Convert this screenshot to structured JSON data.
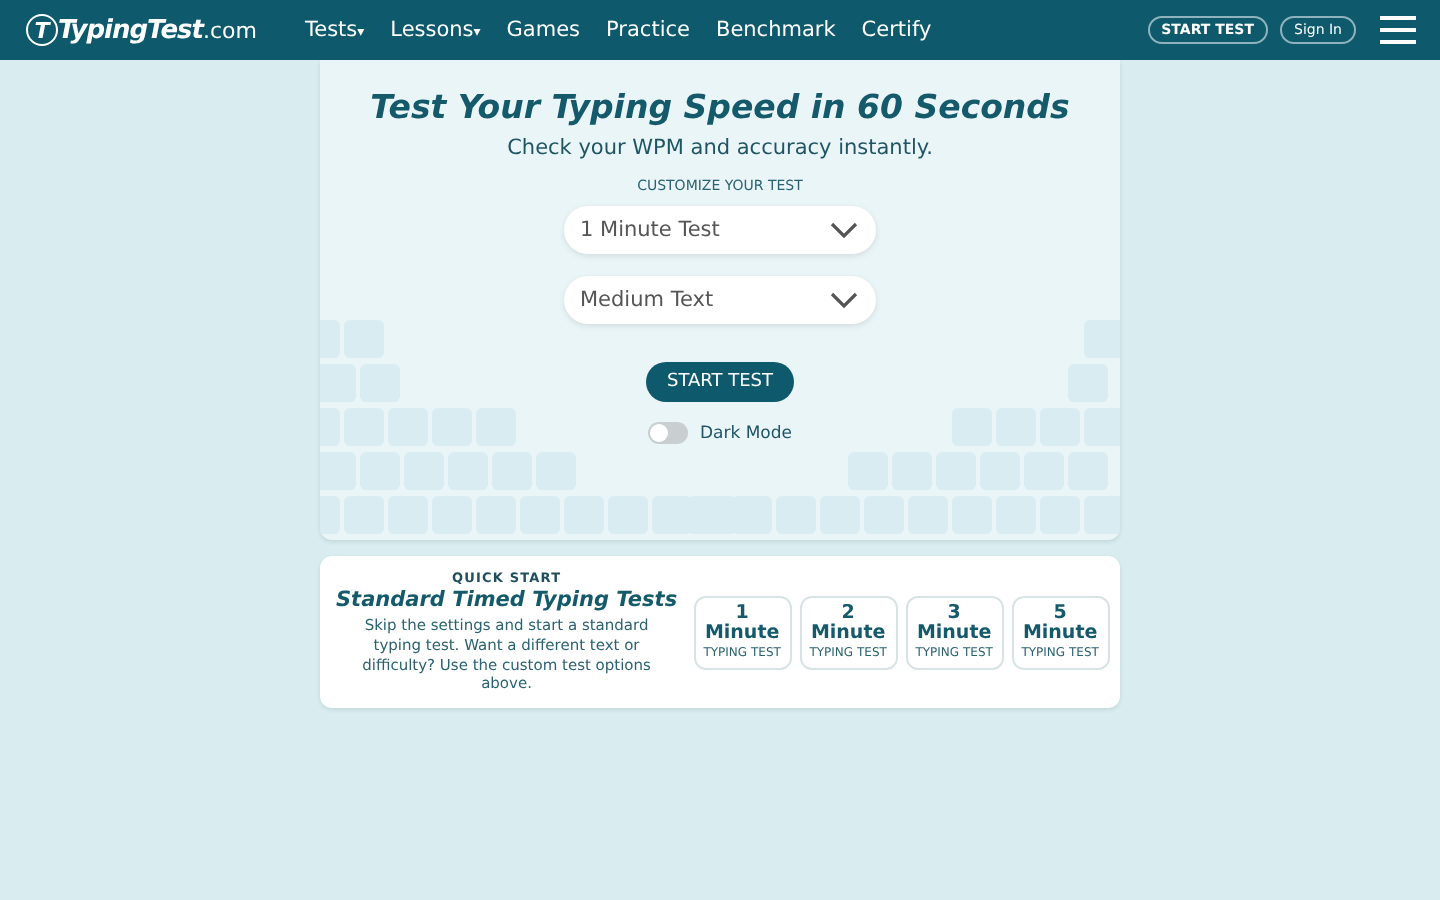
{
  "header": {
    "logo_letter": "T",
    "logo_name": "TypingTest",
    "logo_suffix": ".com",
    "nav": [
      {
        "label": "Tests",
        "kind": "dropdown",
        "caret": "▾"
      },
      {
        "label": "Lessons",
        "kind": "dropdown",
        "caret": "▾"
      },
      {
        "label": "Games",
        "kind": "link"
      },
      {
        "label": "Practice",
        "kind": "link"
      },
      {
        "label": "Benchmark",
        "kind": "link"
      },
      {
        "label": "Certify",
        "kind": "link"
      }
    ],
    "start_button": "START TEST",
    "sign_in": "Sign In"
  },
  "hero": {
    "title": "Test Your Typing Speed in 60 Seconds",
    "subtitle": "Check your WPM and accuracy instantly.",
    "customize_label": "CUSTOMIZE YOUR TEST",
    "selects": [
      {
        "value": "1 Minute Test"
      },
      {
        "value": "Medium Text"
      }
    ],
    "start_button": "START TEST",
    "dark_mode": {
      "label": "Dark Mode",
      "on": false
    }
  },
  "quick_start": {
    "eyebrow": "QUICK START",
    "title": "Standard Timed Typing Tests",
    "description": "Skip the settings and start a standard typing test. Want a different text or difficulty? Use the custom test options above.",
    "tests": [
      {
        "number": "1",
        "unit": "Minute",
        "caption": "TYPING TEST"
      },
      {
        "number": "2",
        "unit": "Minute",
        "caption": "TYPING TEST"
      },
      {
        "number": "3",
        "unit": "Minute",
        "caption": "TYPING TEST"
      },
      {
        "number": "5",
        "unit": "Minute",
        "caption": "TYPING TEST"
      }
    ]
  }
}
